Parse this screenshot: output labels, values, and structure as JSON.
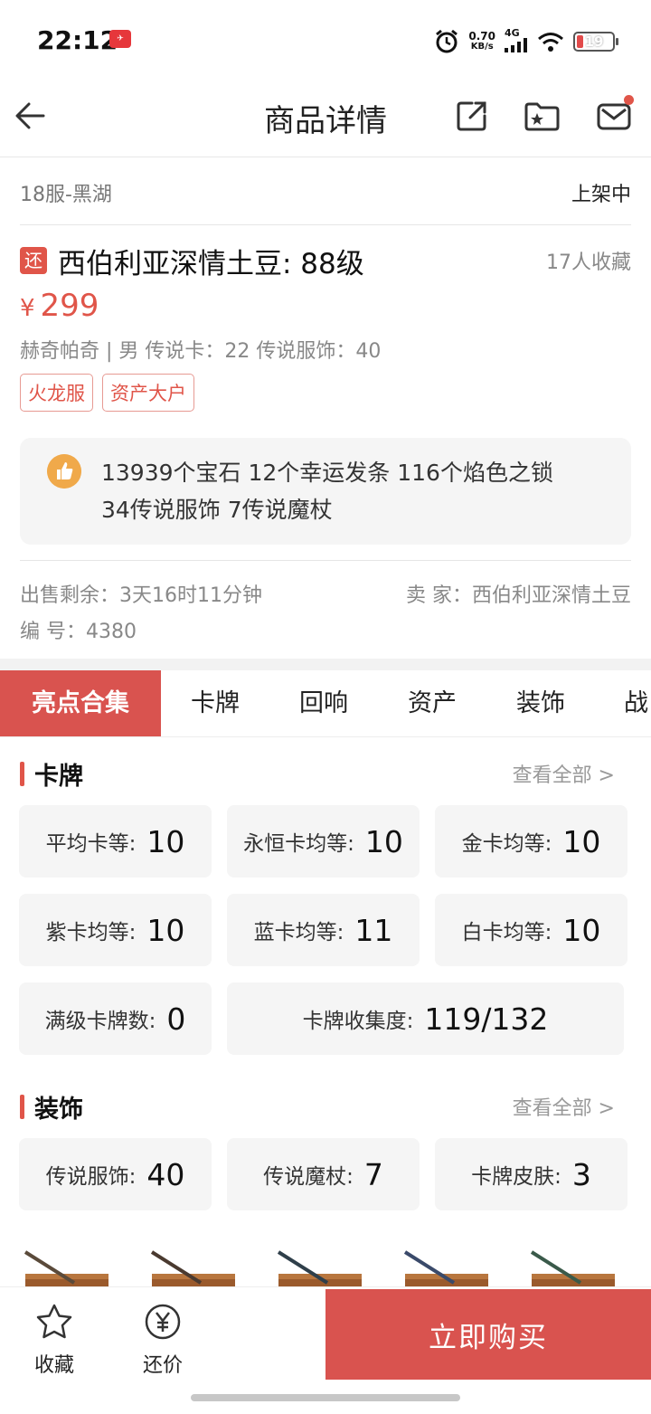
{
  "status_bar": {
    "time": "22:12",
    "notif_text": "去哪儿",
    "speed_value": "0.70",
    "speed_unit": "KB/s",
    "network": "4G",
    "battery": "19"
  },
  "header": {
    "title": "商品详情"
  },
  "listing": {
    "server": "18服-黑湖",
    "status": "上架中",
    "badge": "还",
    "title": "西伯利亚深情土豆: 88级",
    "fav_count": "17人收藏",
    "currency": "¥",
    "price": "299",
    "attributes": "赫奇帕奇 | 男 传说卡：22 传说服饰：40",
    "tags": [
      "火龙服",
      "资产大户"
    ],
    "highlight_line1": "13939个宝石 12个幸运发条 116个焰色之锁",
    "highlight_line2": "34传说服饰 7传说魔杖",
    "remaining": "出售剩余：3天16时11分钟",
    "seller": "卖 家：西伯利亚深情土豆",
    "serial": "编 号：4380"
  },
  "tabs": [
    "亮点合集",
    "卡牌",
    "回响",
    "资产",
    "装饰",
    "战"
  ],
  "cards_section": {
    "title": "卡牌",
    "more": "查看全部 >",
    "stats": [
      {
        "label": "平均卡等:",
        "value": "10"
      },
      {
        "label": "永恒卡均等:",
        "value": "10"
      },
      {
        "label": "金卡均等:",
        "value": "10"
      },
      {
        "label": "紫卡均等:",
        "value": "10"
      },
      {
        "label": "蓝卡均等:",
        "value": "11"
      },
      {
        "label": "白卡均等:",
        "value": "10"
      },
      {
        "label": "满级卡牌数:",
        "value": "0"
      },
      {
        "label": "卡牌收集度:",
        "value": "119/132"
      }
    ]
  },
  "decor_section": {
    "title": "装饰",
    "more": "查看全部 >",
    "stats": [
      {
        "label": "传说服饰:",
        "value": "40"
      },
      {
        "label": "传说魔杖:",
        "value": "7"
      },
      {
        "label": "卡牌皮肤:",
        "value": "3"
      }
    ]
  },
  "bottom_bar": {
    "favorite": "收藏",
    "bargain": "还价",
    "buy": "立即购买"
  },
  "colors": {
    "accent": "#d9534f",
    "price": "#e05549"
  }
}
